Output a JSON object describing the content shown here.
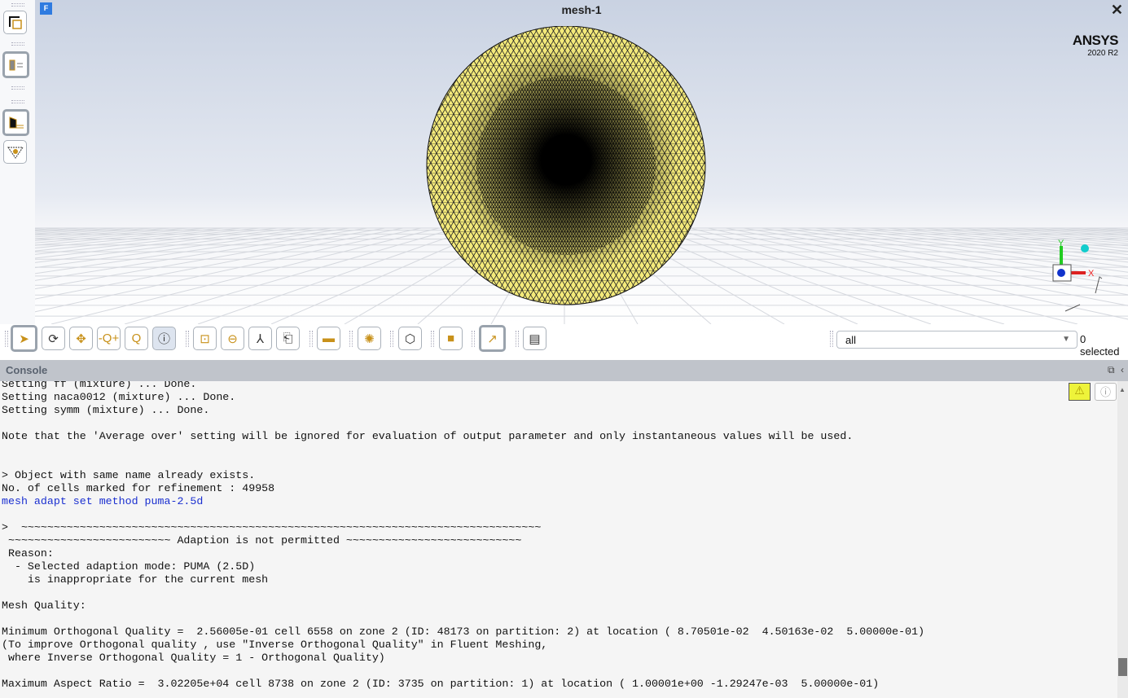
{
  "window": {
    "title": "mesh-1",
    "badge": "F",
    "close": "✕"
  },
  "logo": {
    "brand": "ANSYS",
    "version": "2020 R2"
  },
  "axes": {
    "x": "X",
    "y": "Y"
  },
  "selection": {
    "value": "all",
    "count": "0 selected"
  },
  "console": {
    "title": "Console",
    "lines": [
      {
        "t": "Setting ff (mixture) ... Done."
      },
      {
        "t": "Setting naca0012 (mixture) ... Done."
      },
      {
        "t": "Setting symm (mixture) ... Done."
      },
      {
        "t": ""
      },
      {
        "t": "Note that the 'Average over' setting will be ignored for evaluation of output parameter and only instantaneous values will be used."
      },
      {
        "t": ""
      },
      {
        "t": ""
      },
      {
        "t": "> Object with same name already exists."
      },
      {
        "t": "No. of cells marked for refinement : 49958"
      },
      {
        "t": "mesh adapt set method puma-2.5d",
        "cmd": true
      },
      {
        "t": ""
      },
      {
        "t": ">  ~~~~~~~~~~~~~~~~~~~~~~~~~~~~~~~~~~~~~~~~~~~~~~~~~~~~~~~~~~~~~~~~~~~~~~~~~~~~~~~~"
      },
      {
        "t": " ~~~~~~~~~~~~~~~~~~~~~~~~~ Adaption is not permitted ~~~~~~~~~~~~~~~~~~~~~~~~~~~"
      },
      {
        "t": " Reason:"
      },
      {
        "t": "  - Selected adaption mode: PUMA (2.5D)"
      },
      {
        "t": "    is inappropriate for the current mesh"
      },
      {
        "t": ""
      },
      {
        "t": "Mesh Quality:"
      },
      {
        "t": ""
      },
      {
        "t": "Minimum Orthogonal Quality =  2.56005e-01 cell 6558 on zone 2 (ID: 48173 on partition: 2) at location ( 8.70501e-02  4.50163e-02  5.00000e-01)"
      },
      {
        "t": "(To improve Orthogonal quality , use \"Inverse Orthogonal Quality\" in Fluent Meshing,"
      },
      {
        "t": " where Inverse Orthogonal Quality = 1 - Orthogonal Quality)"
      },
      {
        "t": ""
      },
      {
        "t": "Maximum Aspect Ratio =  3.02205e+04 cell 8738 on zone 2 (ID: 3735 on partition: 1) at location ( 1.00001e+00 -1.29247e-03  5.00000e-01)"
      }
    ]
  },
  "colors": {
    "mesh": "#f4ea7a",
    "accent": "#c8911a",
    "warning": "#eef33a"
  }
}
